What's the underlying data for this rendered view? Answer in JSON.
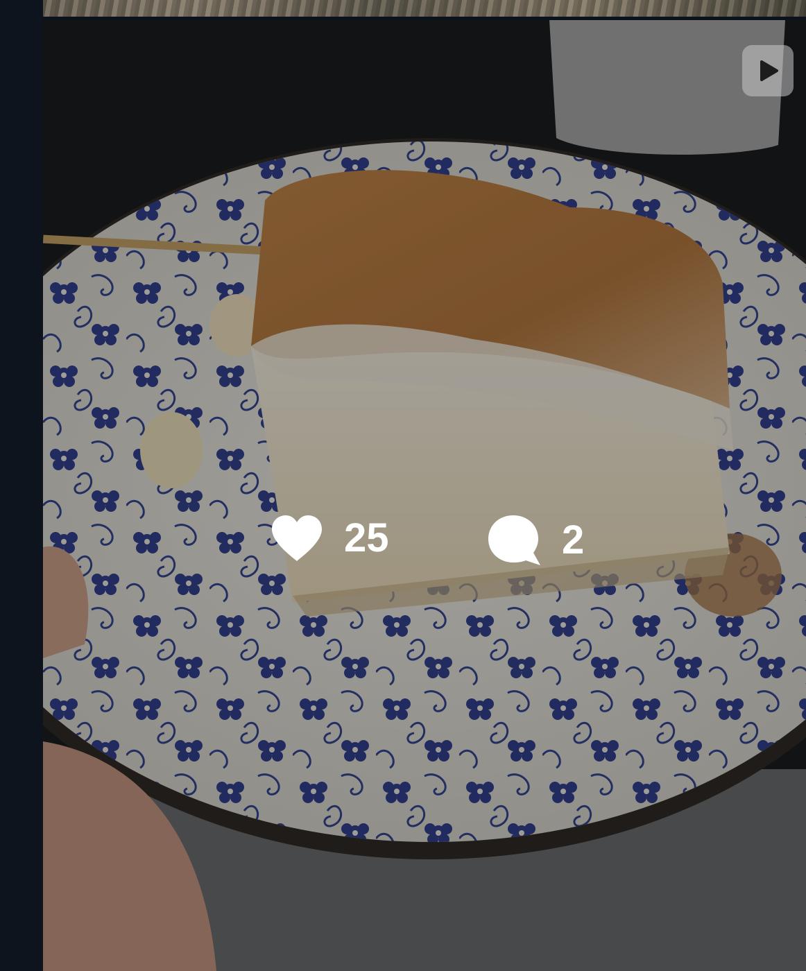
{
  "post": {
    "media_type_icon": "play-icon",
    "image_description_icon": "photo",
    "likes": "25",
    "comments": "2",
    "like_icon": "heart-icon",
    "comment_icon": "comment-bubble-icon"
  },
  "colors": {
    "background": "#0b121b",
    "overlay_text": "#ffffff",
    "plate_blue": "#1f2f7a"
  }
}
